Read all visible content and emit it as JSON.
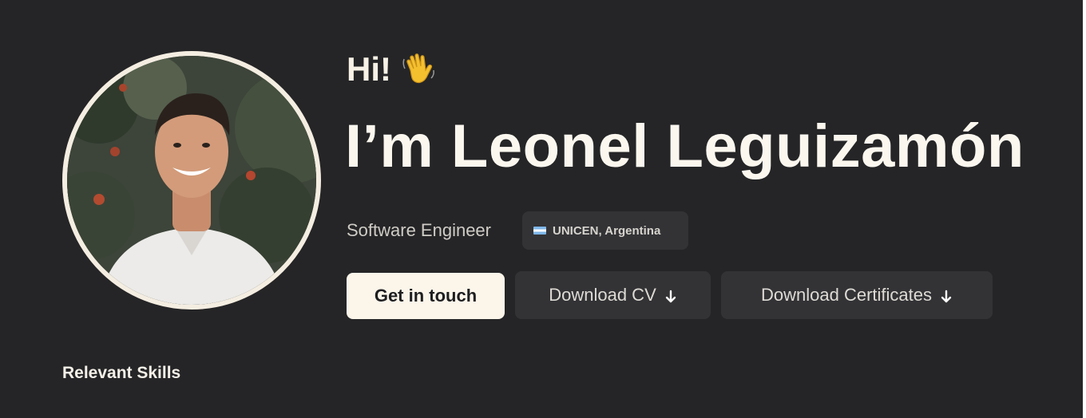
{
  "hero": {
    "greeting": "Hi!",
    "wave_emoji": "👋",
    "name": "I’m Leonel Leguizamón",
    "role": "Software Engineer",
    "location": "UNICEN, Argentina",
    "location_flag": "argentina-flag-icon"
  },
  "actions": {
    "contact_label": "Get in touch",
    "cv_label": "Download CV",
    "certificates_label": "Download Certificates",
    "download_icon": "arrow-down-icon"
  },
  "sections": {
    "skills_title": "Relevant Skills"
  },
  "colors": {
    "background": "#252527",
    "primary_button": "#fbf5ea",
    "secondary_button": "#333336",
    "text": "#fbf7ef"
  }
}
